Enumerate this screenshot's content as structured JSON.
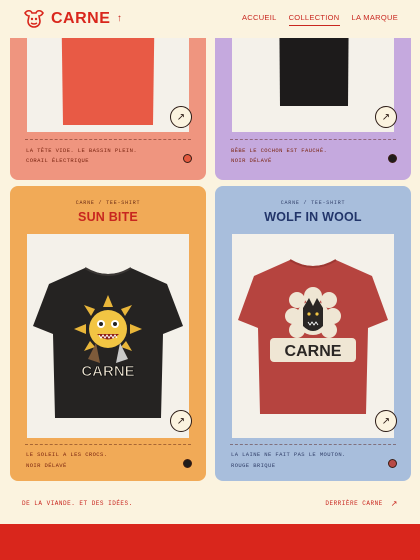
{
  "header": {
    "brand": "CARNE",
    "up_icon": "arrow-up-icon",
    "nav": [
      {
        "label": "ACCUEIL",
        "active": false
      },
      {
        "label": "COLLECTION",
        "active": true
      },
      {
        "label": "LA MARQUE",
        "active": false
      }
    ]
  },
  "cards": [
    {
      "tagline": "LA TÊTE VIDE. LE BASSIN PLEIN.",
      "colour": "CORAIL ÉLECTRIQUE",
      "bg": "#ef957f",
      "swatch": "#e45a3f",
      "shirt": "#e85a45"
    },
    {
      "tagline": "BÊBE LE COCHON EST FAUCHÉ.",
      "colour": "NOIR DÉLAVÉ",
      "bg": "#c5a9de",
      "swatch": "#1f1c1b",
      "shirt": "#1d1b1b"
    },
    {
      "category": "CARNE / TEE-SHIRT",
      "title": "SUN BITE",
      "tagline": "LE SOLEIL A LES CROCS.",
      "colour": "NOIR DÉLAVÉ",
      "bg": "#f1aa57",
      "swatch": "#1f1c1b",
      "shirt": "#252322",
      "graphic_text": "CARNE"
    },
    {
      "category": "CARNE / TEE-SHIRT",
      "title": "WOLF IN WOOL",
      "tagline": "LA LAINE NE FAIT PAS LE MOUTON.",
      "colour": "ROUGE BRIQUE",
      "bg": "#a8bedc",
      "swatch": "#b84a45",
      "shirt": "#b6443f",
      "graphic_text": "CARNE"
    }
  ],
  "open_icon": "arrow-up-right-icon",
  "footer": {
    "left": "DE LA VIANDE. ET DES IDÉES.",
    "right": "DERRIÈRE CARNE"
  }
}
